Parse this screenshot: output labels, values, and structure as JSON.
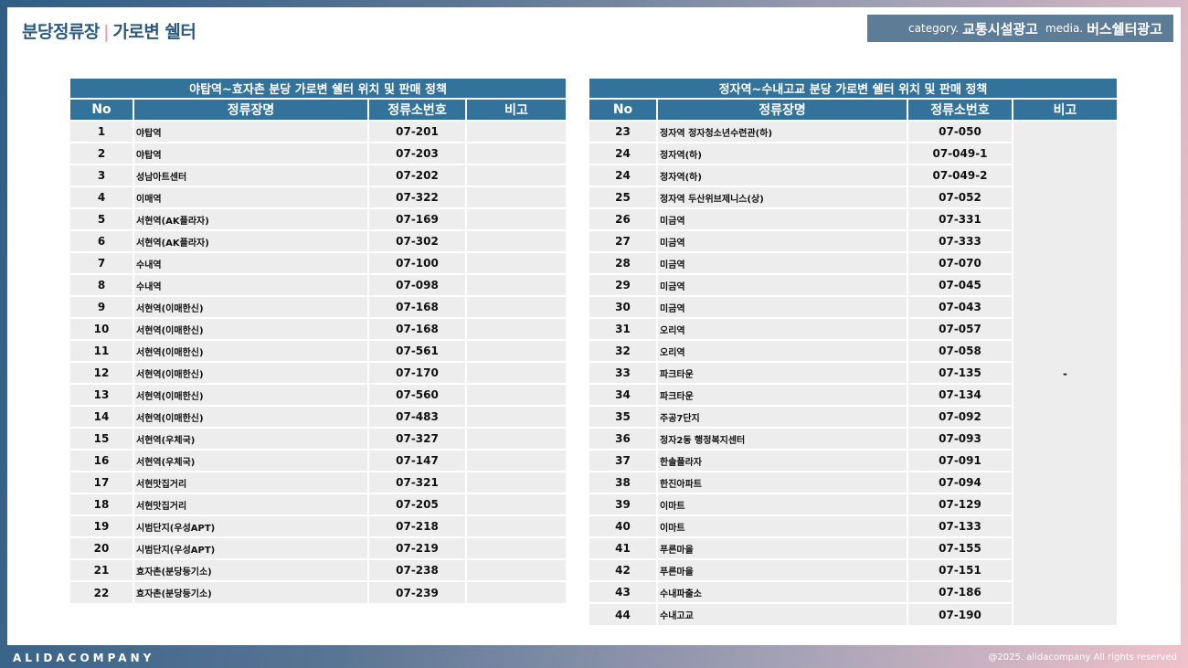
{
  "header": {
    "title_main": "분당정류장",
    "title_sep": "|",
    "title_sub": "가로변 쉘터",
    "category_label": "category.",
    "category_value": "교통시설광고",
    "media_label": "media.",
    "media_value": "버스쉘터광고"
  },
  "columns": [
    "No",
    "정류장명",
    "정류소번호",
    "비고"
  ],
  "left_table": {
    "caption": "야탑역~효자촌 분당 가로변 쉘터 위치 및 판매 정책",
    "rows": [
      [
        "1",
        "야탑역",
        "07-201"
      ],
      [
        "2",
        "야탑역",
        "07-203"
      ],
      [
        "3",
        "성남아트센터",
        "07-202"
      ],
      [
        "4",
        "이매역",
        "07-322"
      ],
      [
        "5",
        "서현역(AK플라자)",
        "07-169"
      ],
      [
        "6",
        "서현역(AK플라자)",
        "07-302"
      ],
      [
        "7",
        "수내역",
        "07-100"
      ],
      [
        "8",
        "수내역",
        "07-098"
      ],
      [
        "9",
        "서현역(이매한신)",
        "07-168"
      ],
      [
        "10",
        "서현역(이매한신)",
        "07-168"
      ],
      [
        "11",
        "서현역(이매한신)",
        "07-561"
      ],
      [
        "12",
        "서현역(이매한신)",
        "07-170"
      ],
      [
        "13",
        "서현역(이매한신)",
        "07-560"
      ],
      [
        "14",
        "서현역(이매한신)",
        "07-483"
      ],
      [
        "15",
        "서현역(우체국)",
        "07-327"
      ],
      [
        "16",
        "서현역(우체국)",
        "07-147"
      ],
      [
        "17",
        "서현맛집거리",
        "07-321"
      ],
      [
        "18",
        "서현맛집거리",
        "07-205"
      ],
      [
        "19",
        "시범단지(우성APT)",
        "07-218"
      ],
      [
        "20",
        "시범단지(우성APT)",
        "07-219"
      ],
      [
        "21",
        "효자촌(분당등기소)",
        "07-238"
      ],
      [
        "22",
        "효자촌(분당등기소)",
        "07-239"
      ]
    ]
  },
  "right_table": {
    "caption": "정자역~수내고교 분당 가로변 쉘터 위치 및 판매 정책",
    "note": "-",
    "rows": [
      [
        "23",
        "정자역 정자청소년수련관(하)",
        "07-050"
      ],
      [
        "24",
        "정자역(하)",
        "07-049-1"
      ],
      [
        "24",
        "정자역(하)",
        "07-049-2"
      ],
      [
        "25",
        "정자역 두산위브제니스(상)",
        "07-052"
      ],
      [
        "26",
        "미금역",
        "07-331"
      ],
      [
        "27",
        "미금역",
        "07-333"
      ],
      [
        "28",
        "미금역",
        "07-070"
      ],
      [
        "29",
        "미금역",
        "07-045"
      ],
      [
        "30",
        "미금역",
        "07-043"
      ],
      [
        "31",
        "오리역",
        "07-057"
      ],
      [
        "32",
        "오리역",
        "07-058"
      ],
      [
        "33",
        "파크타운",
        "07-135"
      ],
      [
        "34",
        "파크타운",
        "07-134"
      ],
      [
        "35",
        "주공7단지",
        "07-092"
      ],
      [
        "36",
        "정자2동 행정복지센터",
        "07-093"
      ],
      [
        "37",
        "한솔플라자",
        "07-091"
      ],
      [
        "38",
        "한진아파트",
        "07-094"
      ],
      [
        "39",
        "이마트",
        "07-129"
      ],
      [
        "40",
        "이마트",
        "07-133"
      ],
      [
        "41",
        "푸른마을",
        "07-155"
      ],
      [
        "42",
        "푸른마을",
        "07-151"
      ],
      [
        "43",
        "수내파출소",
        "07-186"
      ],
      [
        "44",
        "수내고교",
        "07-190"
      ]
    ]
  },
  "footer": {
    "brand": "ALIDACOMPANY",
    "copyright": "@2025. alidacompany All rights reserved"
  },
  "colors": {
    "header_blue": "#33729b",
    "title_blue": "#2c5a7e",
    "accent_pink": "#f0a2b4",
    "cell_gray": "#ededed"
  }
}
